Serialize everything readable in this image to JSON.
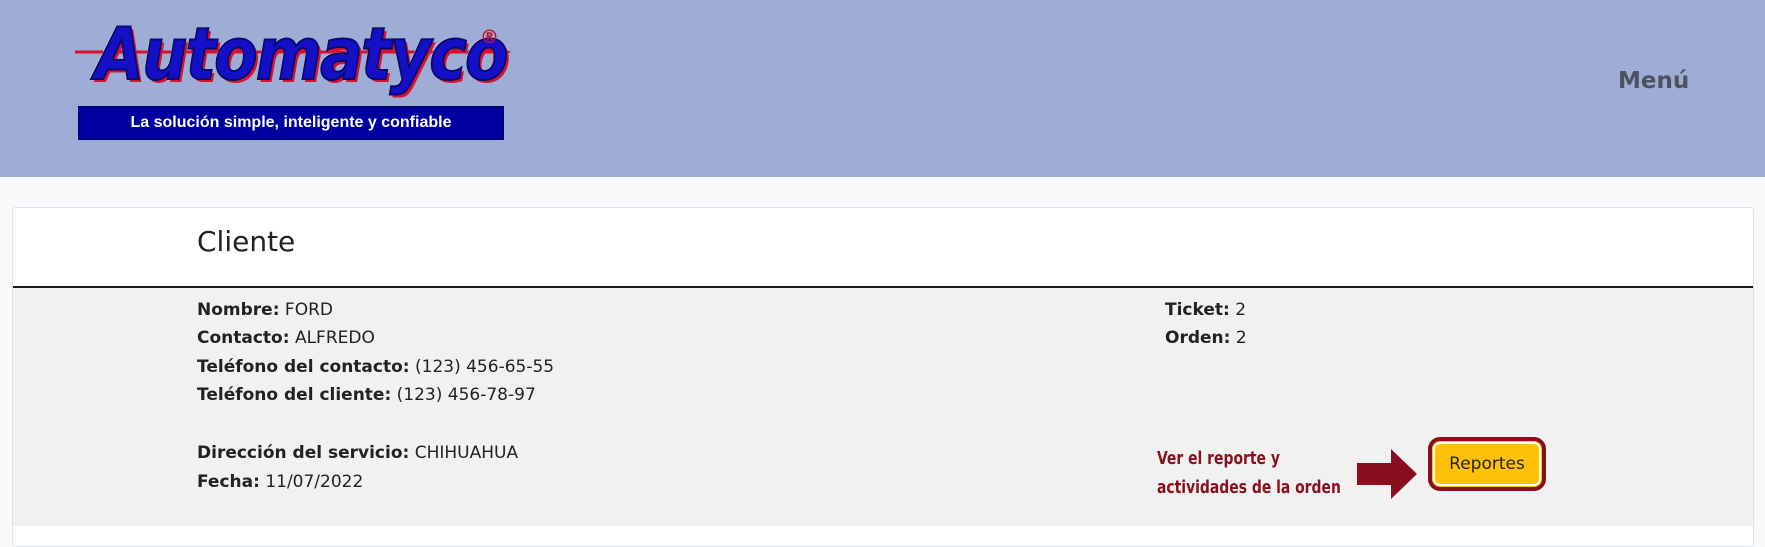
{
  "header": {
    "logo_text": "Automatyco",
    "logo_registered": "®",
    "logo_tagline": "La solución simple, inteligente y confiable",
    "menu_label": "Menú",
    "colors": {
      "header_bg": "#9eadd5",
      "logo_blue": "#1410c8",
      "logo_red": "#d8122c",
      "banner_bg": "#00009e"
    }
  },
  "card": {
    "title": "Cliente",
    "fields": {
      "nombre": {
        "label": "Nombre:",
        "value": "FORD"
      },
      "contacto": {
        "label": "Contacto:",
        "value": "ALFREDO"
      },
      "telefono_contacto": {
        "label": "Teléfono del contacto:",
        "value": "(123) 456-65-55"
      },
      "telefono_cliente": {
        "label": "Teléfono del cliente:",
        "value": "(123) 456-78-97"
      },
      "direccion": {
        "label": "Dirección del servicio:",
        "value": "CHIHUAHUA"
      },
      "fecha": {
        "label": "Fecha:",
        "value": "11/07/2022"
      },
      "ticket": {
        "label": "Ticket:",
        "value": "2"
      },
      "orden": {
        "label": "Orden:",
        "value": "2"
      }
    },
    "annotation": {
      "line1": "Ver el reporte y",
      "line2": "actividades de la orden",
      "color": "#8a0f1e"
    },
    "reportes_button": {
      "label": "Reportes",
      "color": "#ffc107"
    }
  }
}
